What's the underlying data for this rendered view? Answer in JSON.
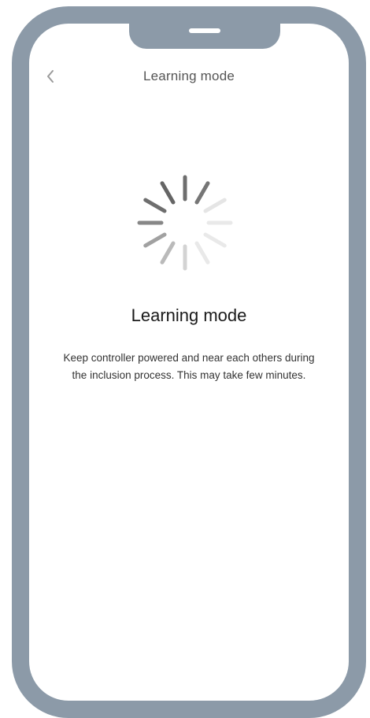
{
  "header": {
    "title": "Learning mode",
    "back_icon": "chevron-left-icon"
  },
  "content": {
    "spinner_icon": "loading-spinner-icon",
    "title": "Learning mode",
    "description": "Keep controller powered and near each others during the inclusion process. This may take few minutes."
  },
  "colors": {
    "frame": "#8c9aa8",
    "background": "#ffffff",
    "spinner": "#555555",
    "title_text": "#1a1a1a",
    "body_text": "#333333"
  }
}
